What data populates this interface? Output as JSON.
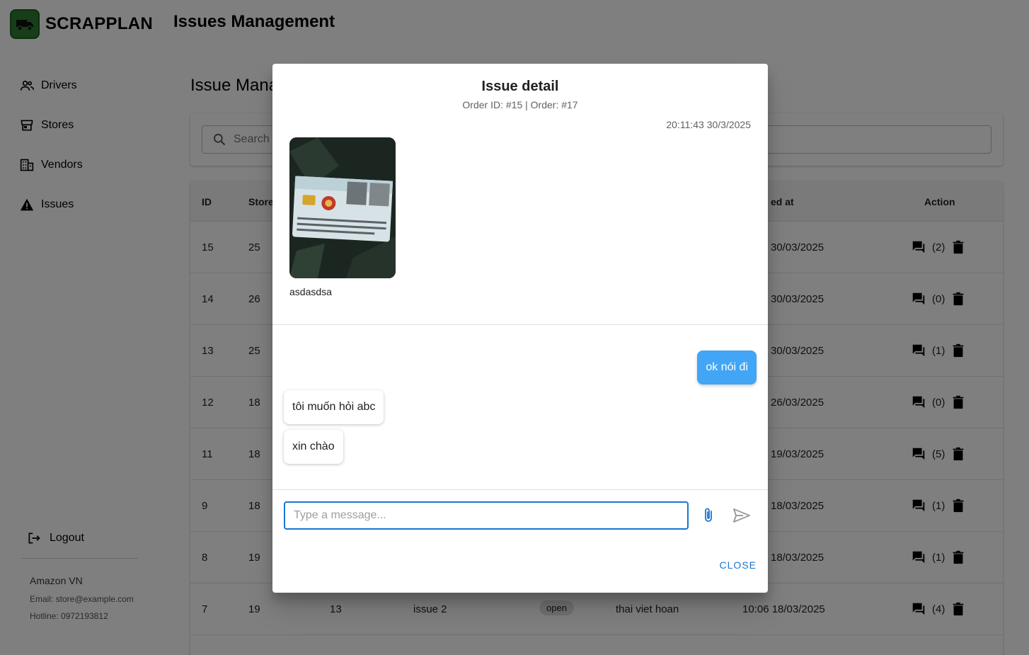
{
  "app": {
    "brand": "SCRAPPLAN",
    "title": "Issues Management"
  },
  "sidebar": {
    "items": [
      {
        "label": "Drivers",
        "icon": "people-icon"
      },
      {
        "label": "Stores",
        "icon": "store-icon"
      },
      {
        "label": "Vendors",
        "icon": "building-icon"
      },
      {
        "label": "Issues",
        "icon": "warning-icon"
      }
    ],
    "logout_label": "Logout",
    "store_name": "Amazon VN",
    "store_email": "Email: store@example.com",
    "store_hotline": "Hotline: 0972193812"
  },
  "main": {
    "heading": "Issue Mana",
    "search_placeholder": "Search",
    "columns": {
      "id": "ID",
      "store": "Store",
      "created_at": "ed at",
      "action": "Action"
    },
    "rows": [
      {
        "id": "15",
        "store": "25",
        "created_at": "30/03/2025",
        "count": "(2)"
      },
      {
        "id": "14",
        "store": "26",
        "created_at": "30/03/2025",
        "count": "(0)"
      },
      {
        "id": "13",
        "store": "25",
        "created_at": "30/03/2025",
        "count": "(1)"
      },
      {
        "id": "12",
        "store": "18",
        "created_at": "26/03/2025",
        "count": "(0)"
      },
      {
        "id": "11",
        "store": "18",
        "created_at": "19/03/2025",
        "count": "(5)"
      },
      {
        "id": "9",
        "store": "18",
        "created_at": "18/03/2025",
        "count": "(1)"
      },
      {
        "id": "8",
        "store": "19",
        "created_at": "18/03/2025",
        "count": "(1)"
      },
      {
        "id": "7",
        "store": "19",
        "order": "13",
        "title": "issue 2",
        "status": "open",
        "driver": "thai viet hoan",
        "created_at": "10:06 18/03/2025",
        "count": "(4)"
      }
    ]
  },
  "modal": {
    "title": "Issue detail",
    "subtitle": "Order ID: #15 | Order: #17",
    "timestamp": "20:11:43 30/3/2025",
    "description": "asdasdsa",
    "messages": [
      {
        "text": "ok nói đi",
        "from": "me"
      },
      {
        "text": "tôi muốn hỏi abc",
        "from": "other"
      },
      {
        "text": "xin chào",
        "from": "other"
      }
    ],
    "input_placeholder": "Type a message...",
    "close_label": "CLOSE"
  },
  "colors": {
    "accent": "#1976d2",
    "bubble_mine": "#42a5f5",
    "brand_icon_bg": "#2e7d32"
  }
}
